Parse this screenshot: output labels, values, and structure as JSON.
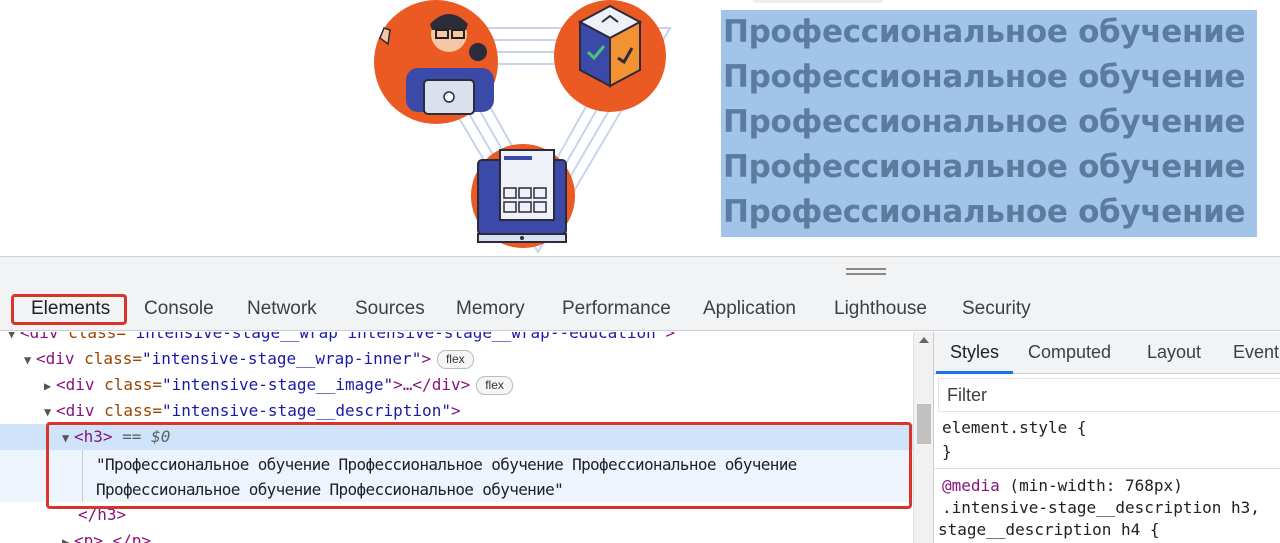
{
  "page": {
    "selected_heading_lines": [
      "Профессиональное обучение",
      "Профессиональное обучение",
      "Профессиональное обучение",
      "Профессиональное обучение",
      "Профессиональное обучение"
    ]
  },
  "devtools": {
    "tabs": [
      "Elements",
      "Console",
      "Network",
      "Sources",
      "Memory",
      "Performance",
      "Application",
      "Lighthouse",
      "Security"
    ],
    "active_tab": "Elements",
    "tree": {
      "row0": {
        "tag_open": "<div",
        "attr": " class=",
        "val": "\"intensive-stage__wrap intensive-stage__wrap--education\"",
        "close": ">"
      },
      "row1": {
        "tag_open": "<div",
        "attr": " class=",
        "val": "\"intensive-stage__wrap-inner\"",
        "close": ">",
        "badge": "flex"
      },
      "row2": {
        "tag_open": "<div",
        "attr": " class=",
        "val": "\"intensive-stage__image\"",
        "close": ">…</div>",
        "badge": "flex"
      },
      "row3": {
        "tag_open": "<div",
        "attr": " class=",
        "val": "\"intensive-stage__description\"",
        "close": ">"
      },
      "row4": {
        "tag": "<h3>",
        "marker": " == $0"
      },
      "text_line1": "\"Профессиональное обучение Профессиональное обучение Профессиональное обучение",
      "text_line2": "Профессиональное обучение Профессиональное обучение\"",
      "row_close_h3": "</h3>",
      "row_p": "<p>…</p>"
    },
    "styles": {
      "subtabs": [
        "Styles",
        "Computed",
        "Layout",
        "Event"
      ],
      "active_subtab": "Styles",
      "filter_placeholder": "Filter",
      "element_style_open": "element.style {",
      "element_style_close": "}",
      "media_at": "@media",
      "media_cond": " (min-width: 768px)",
      "selector_line1": ".intensive-stage__description h3,",
      "selector_line2": "stage__description h4 {"
    }
  },
  "colors": {
    "selection": "#a2c4e8",
    "selection_text": "#5b7b9f",
    "highlight_box": "#d9342b",
    "illustration_orange": "#ec5a24",
    "illustration_navy": "#2f3f8f"
  }
}
